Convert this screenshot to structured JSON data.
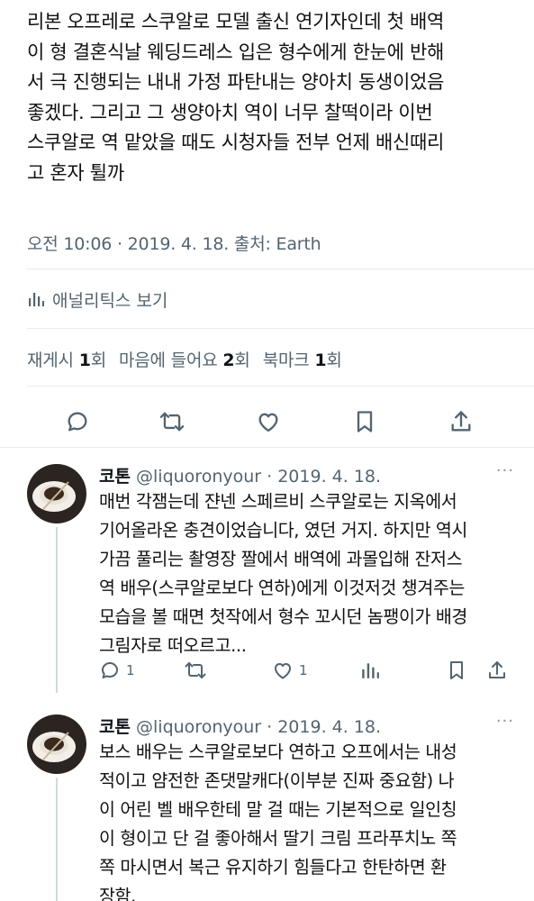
{
  "tweet": {
    "text": "리본 오프레로 스쿠알로 모델 출신 연기자인데 첫 배역\n이 형 결혼식날 웨딩드레스 입은 형수에게 한눈에 반해\n서 극 진행되는 내내 가정 파탄내는 양아치 동생이었음\n좋겠다. 그리고 그 생양아치 역이 너무 찰떡이라 이번\n스쿠알로 역 맡았을 때도 시청자들 전부 언제 배신때리\n고 혼자 튈까",
    "timestamp": "오전 10:06 · 2019. 4. 18. 출처: Earth",
    "analytics_label": "애널리틱스 보기",
    "stats": {
      "retweets_label": "재게시",
      "retweets_count": "1",
      "retweets_unit": "회",
      "likes_label": "마음에 들어요",
      "likes_count": "2",
      "likes_unit": "회",
      "bookmarks_label": "북마크",
      "bookmarks_count": "1",
      "bookmarks_unit": "회"
    },
    "actions": [
      "reply-icon",
      "retweet-icon",
      "heart-icon",
      "bookmark-icon",
      "share-icon"
    ]
  },
  "replies": [
    {
      "name": "코톤",
      "handle": "@liquoronyour",
      "date": "· 2019. 4. 18.",
      "more": "···",
      "text": "매번 각잼는데 쟌넨 스페르비 스쿠알로는 지옥에서\n기어올라온 충견이었습니다, 였던 거지. 하지만 역시\n가끔 풀리는 촬영장 짤에서 배역에 과몰입해 잔저스\n역 배우(스쿠알로보다 연하)에게 이것저것 챙겨주는\n모습을 볼 때면 첫작에서 형수 꼬시던 놈팽이가 배경\n그림자로 떠오르고...",
      "reply_count": "1",
      "like_count": "1"
    },
    {
      "name": "코톤",
      "handle": "@liquoronyour",
      "date": "· 2019. 4. 18.",
      "more": "···",
      "text": "보스 배우는 스쿠알로보다 연하고 오프에서는 내성\n적이고 얌전한 존댓말캐다(이부분 진짜 중요함) 나\n이 어린 벨 배우한테 말 걸 때는 기본적으로 일인칭\n이 형이고 단 걸 좋아해서 딸기 크림 프라푸치노 쪽\n쪽 마시면서 복근 유지하기 힘들다고 한탄하면 환\n장함."
    }
  ],
  "colors": {
    "text": "#0f1419",
    "secondary": "#536471",
    "divider": "#e6ecf0",
    "thread_line": "#cfd9de"
  }
}
